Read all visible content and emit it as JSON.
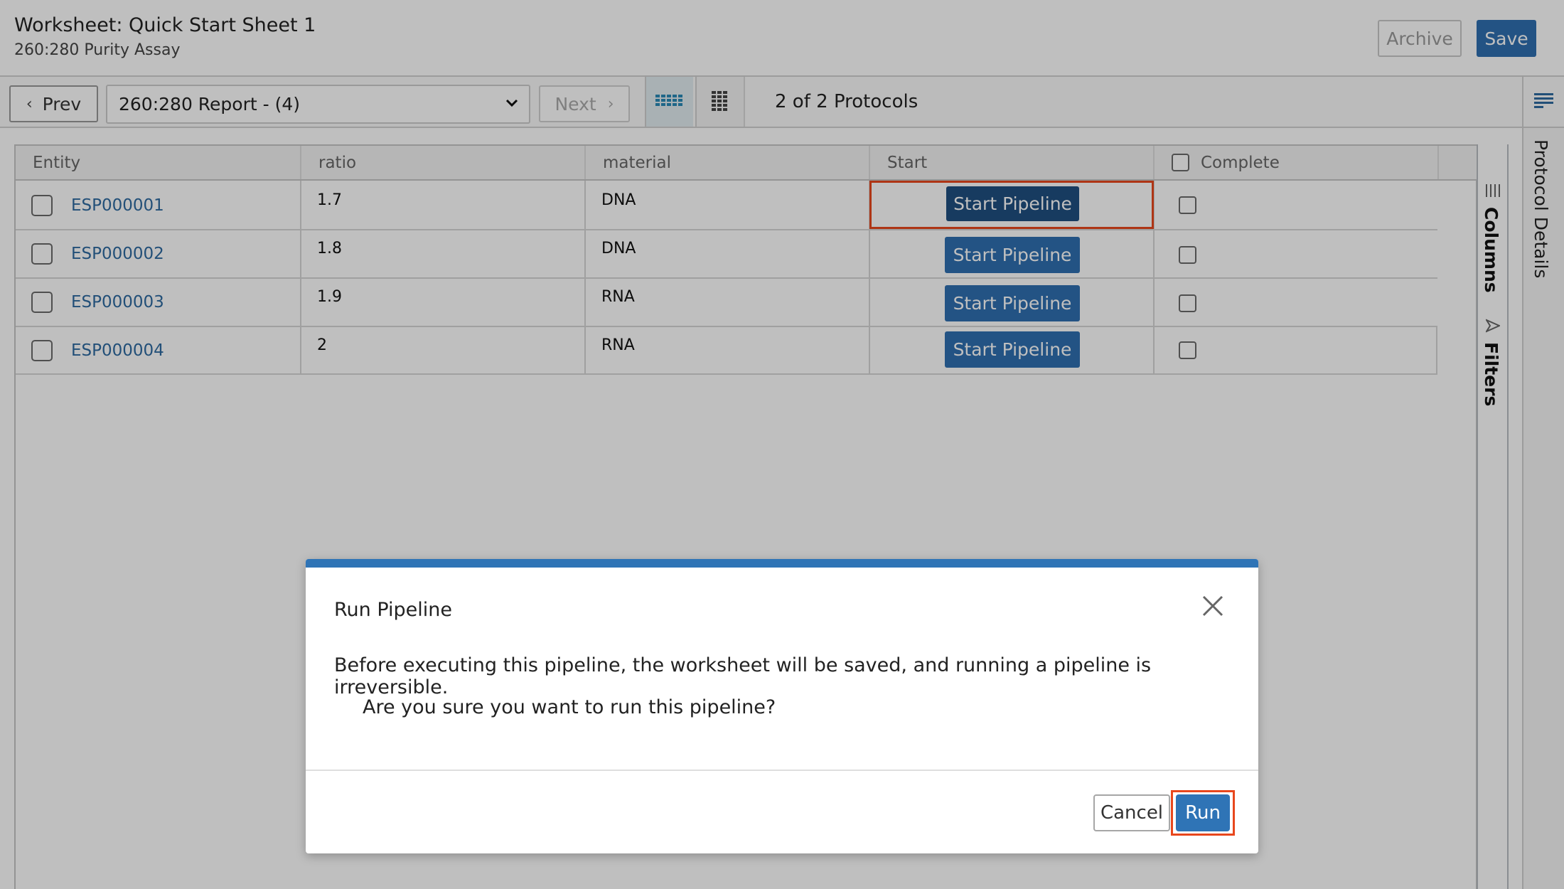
{
  "header": {
    "title": "Worksheet: Quick Start Sheet 1",
    "subtitle": "260:280 Purity Assay",
    "archive_label": "Archive",
    "save_label": "Save"
  },
  "toolbar": {
    "prev_label": "Prev",
    "next_label": "Next",
    "protocol_select_value": "260:280 Report - (4)",
    "protocol_count": "2 of 2 Protocols",
    "view_toggle_icons": [
      "grid-wide-icon",
      "grid-compact-icon"
    ],
    "active_view": "grid-wide"
  },
  "right_rail": {
    "icon": "protocol-details-icon",
    "label": "Protocol Details"
  },
  "side_strip": {
    "columns_label": "Columns",
    "filters_label": "Filters"
  },
  "grid": {
    "columns": [
      "Entity",
      "ratio",
      "material",
      "Start",
      "Complete"
    ],
    "rows": [
      {
        "entity": "ESP000001",
        "ratio": "1.7",
        "material": "DNA",
        "start": "Start Pipeline",
        "complete": false
      },
      {
        "entity": "ESP000002",
        "ratio": "1.8",
        "material": "DNA",
        "start": "Start Pipeline",
        "complete": false
      },
      {
        "entity": "ESP000003",
        "ratio": "1.9",
        "material": "RNA",
        "start": "Start Pipeline",
        "complete": false
      },
      {
        "entity": "ESP000004",
        "ratio": "2",
        "material": "RNA",
        "start": "Start Pipeline",
        "complete": false
      }
    ]
  },
  "dialog": {
    "title": "Run Pipeline",
    "message": "Before executing this pipeline, the worksheet will be saved, and running a pipeline is irreversible.",
    "question": "Are you sure you want to run this pipeline?",
    "cancel_label": "Cancel",
    "run_label": "Run"
  },
  "colors": {
    "primary": "#2f74b6",
    "primary_dark": "#1f4f80",
    "link": "#2e6aa0",
    "highlight": "#e8471d"
  }
}
